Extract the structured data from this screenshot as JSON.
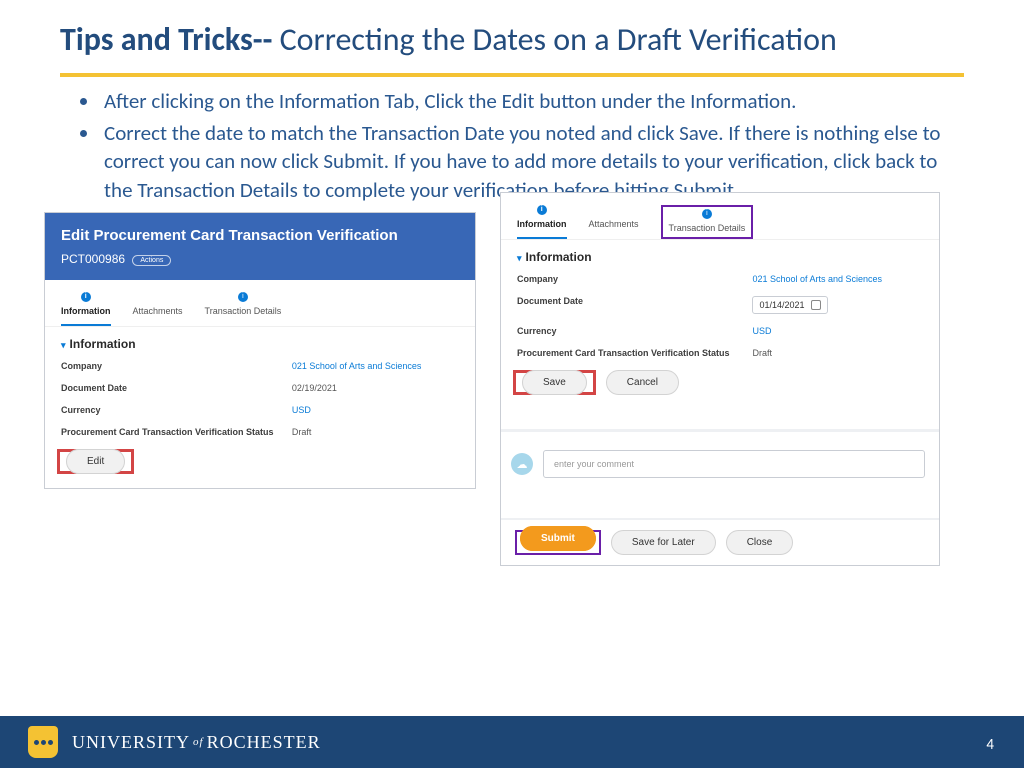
{
  "title_bold": "Tips and Tricks--",
  "title_light": " Correcting the Dates on a Draft Verification",
  "bullets": [
    "After clicking on the Information Tab, Click the Edit button under the Information.",
    "Correct the date to match the Transaction Date you noted and click Save.  If there is nothing else to correct you can now click Submit.  If you have to add more details to your verification, click back to the Transaction Details to complete your verification before hitting Submit."
  ],
  "left": {
    "header_title": "Edit Procurement Card Transaction Verification",
    "header_id": "PCT000986",
    "actions": "Actions",
    "tabs": [
      "Information",
      "Attachments",
      "Transaction Details"
    ],
    "section": "Information",
    "rows": {
      "company_k": "Company",
      "company_v": "021 School of Arts and Sciences",
      "date_k": "Document Date",
      "date_v": "02/19/2021",
      "curr_k": "Currency",
      "curr_v": "USD",
      "status_k": "Procurement Card Transaction Verification Status",
      "status_v": "Draft"
    },
    "edit": "Edit"
  },
  "right": {
    "tabs": [
      "Information",
      "Attachments",
      "Transaction Details"
    ],
    "section": "Information",
    "rows": {
      "company_k": "Company",
      "company_v": "021 School of Arts and Sciences",
      "date_k": "Document Date",
      "date_v": "01/14/2021",
      "curr_k": "Currency",
      "curr_v": "USD",
      "status_k": "Procurement Card Transaction Verification Status",
      "status_v": "Draft"
    },
    "save": "Save",
    "cancel": "Cancel",
    "comment_placeholder": "enter your comment",
    "submit": "Submit",
    "save_later": "Save for Later",
    "close": "Close"
  },
  "footer": {
    "uni_a": "UNIVERSITY",
    "of": "of",
    "uni_b": "ROCHESTER"
  },
  "slide_number": "4"
}
